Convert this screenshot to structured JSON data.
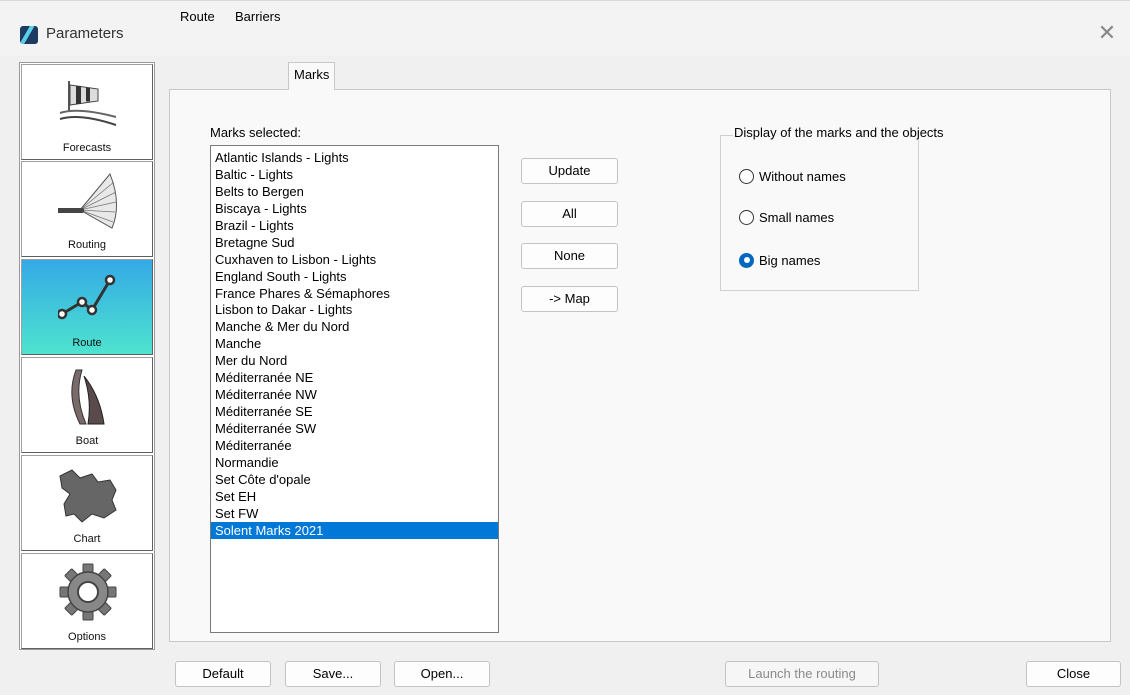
{
  "window": {
    "title": "Parameters"
  },
  "sidebar": {
    "items": [
      {
        "label": "Forecasts",
        "icon": "windsock-icon",
        "active": false
      },
      {
        "label": "Routing",
        "icon": "routing-fan-icon",
        "active": false
      },
      {
        "label": "Route",
        "icon": "route-path-icon",
        "active": true
      },
      {
        "label": "Boat",
        "icon": "sail-icon",
        "active": false
      },
      {
        "label": "Chart",
        "icon": "map-region-icon",
        "active": false
      },
      {
        "label": "Options",
        "icon": "gear-icon",
        "active": false
      }
    ]
  },
  "tabs": [
    {
      "label": "Route",
      "active": false
    },
    {
      "label": "Barriers",
      "active": false
    },
    {
      "label": "Marks",
      "active": true
    }
  ],
  "marks": {
    "label": "Marks selected:",
    "items": [
      "Atlantic Islands - Lights",
      "Baltic - Lights",
      "Belts to Bergen",
      "Biscaya - Lights",
      "Brazil - Lights",
      "Bretagne Sud",
      "Cuxhaven to Lisbon - Lights",
      "England South - Lights",
      "France Phares & Sémaphores",
      "Lisbon to Dakar - Lights",
      "Manche & Mer du Nord",
      "Manche",
      "Mer du Nord",
      "Méditerranée NE",
      "Méditerranée NW",
      "Méditerranée SE",
      "Méditerranée SW",
      "Méditerranée",
      "Normandie",
      "Set Côte d'opale",
      "Set EH",
      "Set FW",
      "Solent Marks 2021"
    ],
    "selected_item": "Solent Marks 2021"
  },
  "buttons": {
    "update": "Update",
    "all": "All",
    "none": "None",
    "to_map": "-> Map"
  },
  "display_group": {
    "title": "Display of the marks and the objects",
    "options": [
      {
        "label": "Without names",
        "checked": false
      },
      {
        "label": "Small names",
        "checked": false
      },
      {
        "label": "Big names",
        "checked": true
      }
    ]
  },
  "footer": {
    "default": "Default",
    "save": "Save...",
    "open": "Open...",
    "launch": "Launch the routing",
    "close": "Close"
  },
  "colors": {
    "accent": "#0078d7",
    "active_tile_top": "#34a9e6",
    "active_tile_bottom": "#4ee3cf"
  }
}
